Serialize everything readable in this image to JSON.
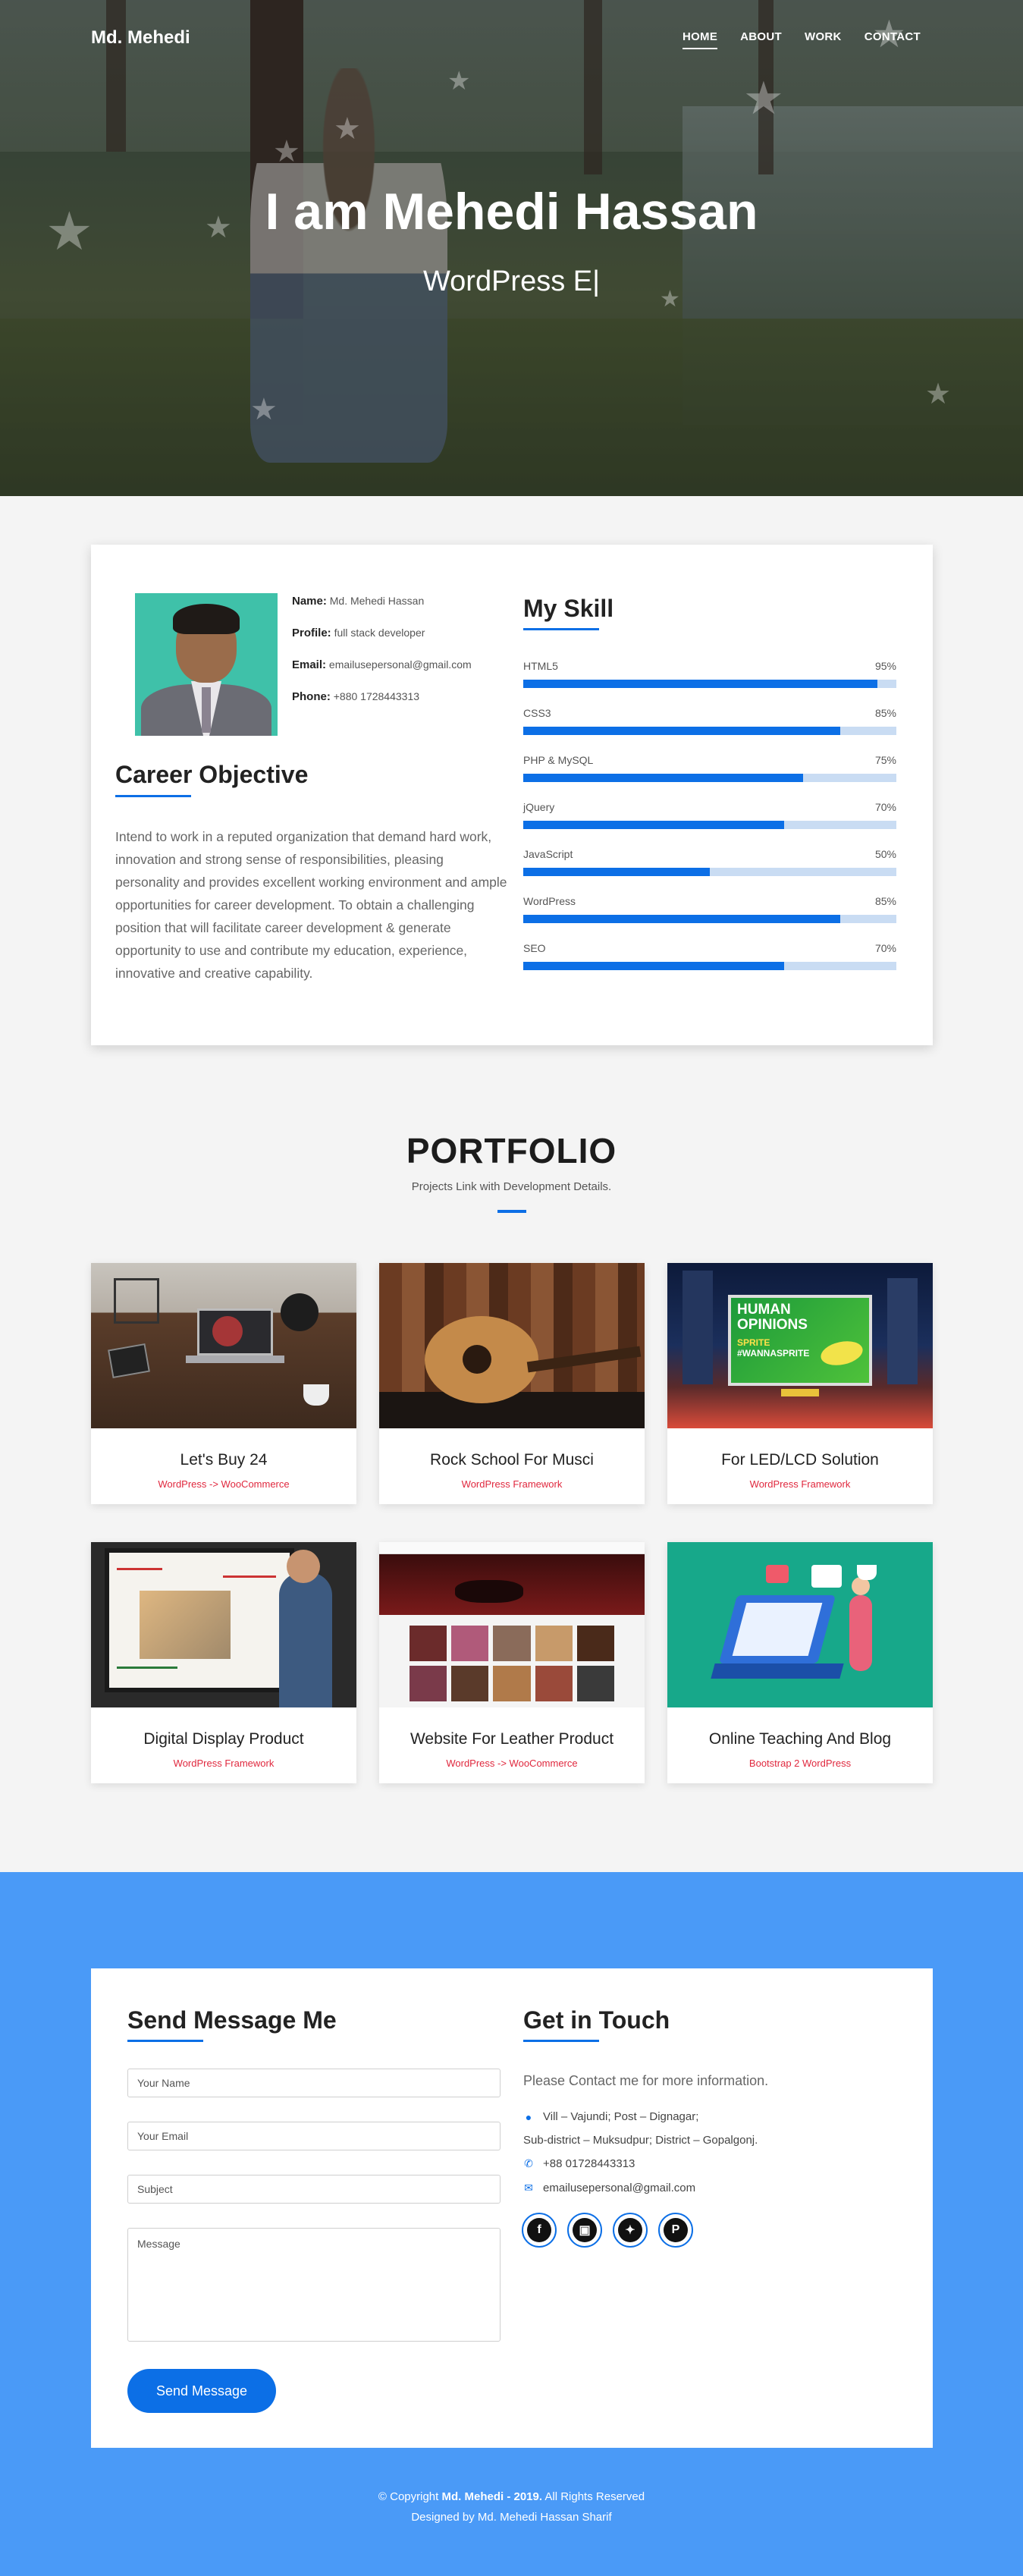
{
  "nav": {
    "brand": "Md. Mehedi",
    "items": [
      {
        "label": "HOME",
        "active": true
      },
      {
        "label": "ABOUT",
        "active": false
      },
      {
        "label": "WORK",
        "active": false
      },
      {
        "label": "CONTACT",
        "active": false
      }
    ]
  },
  "hero": {
    "title": "I am Mehedi Hassan",
    "typed": "WordPress E|"
  },
  "about": {
    "name_label": "Name:",
    "name_value": "Md. Mehedi Hassan",
    "profile_label": "Profile:",
    "profile_value": "full stack developer",
    "email_label": "Email:",
    "email_value": "emailusepersonal@gmail.com",
    "phone_label": "Phone:",
    "phone_value": "+880 1728443313",
    "career_heading": "Career Objective",
    "career_text": "Intend to work in a reputed organization that demand hard work, innovation and strong sense of responsibilities, pleasing personality and provides excellent working environment and ample opportunities for career development. To obtain a challenging position that will facilitate career development & generate opportunity to use and contribute my education, experience, innovative and creative capability.",
    "skills_heading": "My Skill",
    "skills": [
      {
        "name": "HTML5",
        "percent": "95%",
        "value": 95
      },
      {
        "name": "CSS3",
        "percent": "85%",
        "value": 85
      },
      {
        "name": "PHP & MySQL",
        "percent": "75%",
        "value": 75
      },
      {
        "name": "jQuery",
        "percent": "70%",
        "value": 70
      },
      {
        "name": "JavaScript",
        "percent": "50%",
        "value": 50
      },
      {
        "name": "WordPress",
        "percent": "85%",
        "value": 85
      },
      {
        "name": "SEO",
        "percent": "70%",
        "value": 70
      }
    ]
  },
  "portfolio": {
    "title": "PORTFOLIO",
    "subtitle": "Projects Link with Development Details.",
    "items": [
      {
        "title": "Let's Buy 24",
        "tag": "WordPress -> WooCommerce",
        "image": "desk-laptop"
      },
      {
        "title": "Rock School For Musci",
        "tag": "WordPress Framework",
        "image": "guitar"
      },
      {
        "title": "For LED/LCD Solution",
        "tag": "WordPress Framework",
        "image": "billboard"
      },
      {
        "title": "Digital Display Product",
        "tag": "WordPress Framework",
        "image": "smartboard"
      },
      {
        "title": "Website For Leather Product",
        "tag": "WordPress -> WooCommerce",
        "image": "leather-site"
      },
      {
        "title": "Online Teaching And Blog",
        "tag": "Bootstrap 2 WordPress",
        "image": "teaching-illustration"
      }
    ],
    "billboard_text": [
      "HUMAN",
      "OPINIONS",
      "SPRITE",
      "#WANNASPRITE"
    ]
  },
  "contact": {
    "send_heading": "Send Message Me",
    "placeholders": {
      "name": "Your Name",
      "email": "Your Email",
      "subject": "Subject",
      "message": "Message"
    },
    "send_button": "Send Message",
    "touch_heading": "Get in Touch",
    "touch_text": "Please Contact me for more information.",
    "address1": "Vill – Vajundi; Post – Dignagar;",
    "address2": "Sub-district – Muksudpur; District – Gopalgonj.",
    "phone": "+88 01728443313",
    "email": "emailusepersonal@gmail.com",
    "socials": [
      {
        "icon": "facebook-icon",
        "glyph": "f"
      },
      {
        "icon": "instagram-icon",
        "glyph": "▣"
      },
      {
        "icon": "twitter-icon",
        "glyph": "✦"
      },
      {
        "icon": "pinterest-icon",
        "glyph": "P"
      }
    ]
  },
  "footer": {
    "copyright_prefix": "© Copyright ",
    "copyright_strong": "Md. Mehedi - 2019.",
    "copyright_suffix": " All Rights Reserved",
    "designed": "Designed by Md. Mehedi Hassan Sharif"
  },
  "colors": {
    "accent": "#0c6fe6",
    "contact_bg": "#4a9af7",
    "tag": "#e0283e"
  }
}
